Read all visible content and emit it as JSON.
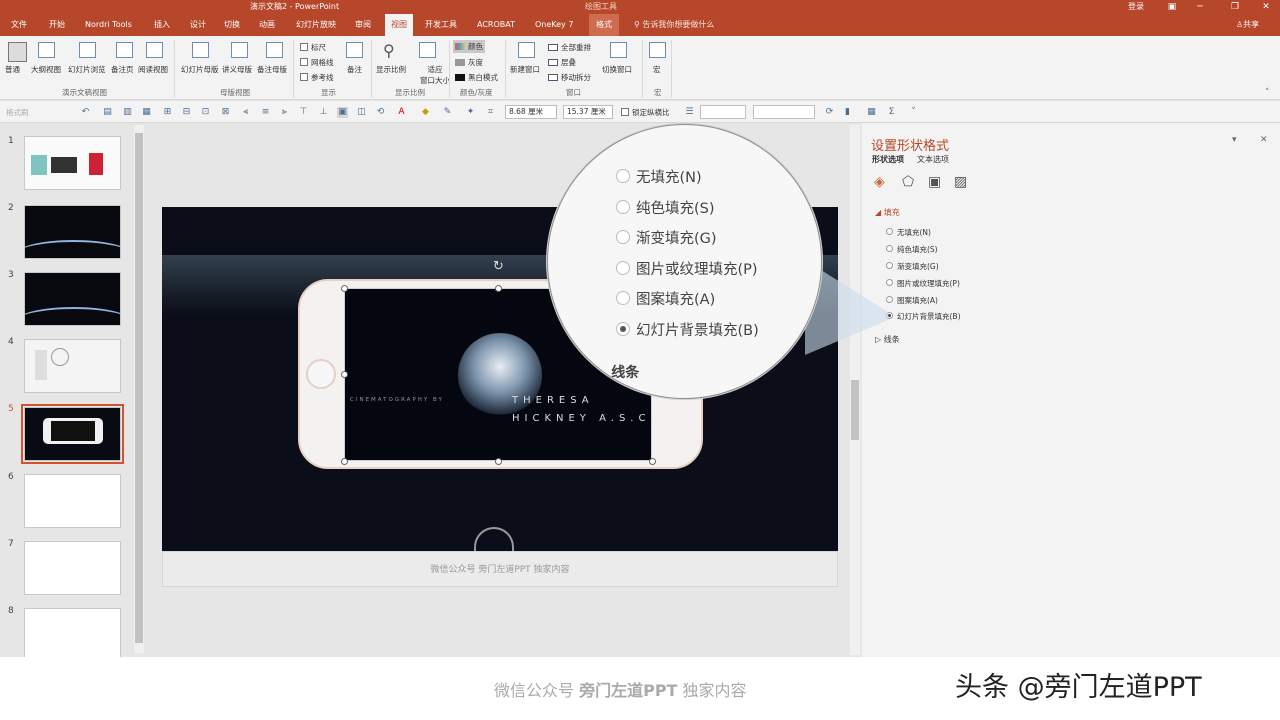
{
  "titlebar": {
    "title": "演示文稿2  -  PowerPoint",
    "context": "绘图工具",
    "login": "登录",
    "share": "共享"
  },
  "tabs": [
    {
      "label": "文件",
      "active": false
    },
    {
      "label": "开始",
      "active": false
    },
    {
      "label": "Nordri Tools",
      "active": false
    },
    {
      "label": "插入",
      "active": false
    },
    {
      "label": "设计",
      "active": false
    },
    {
      "label": "切换",
      "active": false
    },
    {
      "label": "动画",
      "active": false
    },
    {
      "label": "幻灯片放映",
      "active": false
    },
    {
      "label": "审阅",
      "active": false
    },
    {
      "label": "视图",
      "active": true
    },
    {
      "label": "开发工具",
      "active": false
    },
    {
      "label": "ACROBAT",
      "active": false
    },
    {
      "label": "OneKey 7",
      "active": false
    },
    {
      "label": "格式",
      "active": false
    }
  ],
  "tell_me": "告诉我你想要做什么",
  "ribbon": {
    "presentation_views": [
      "普通",
      "大纲视图",
      "幻灯片浏览",
      "备注页",
      "阅读视图"
    ],
    "master_views": [
      "幻灯片母版",
      "讲义母版",
      "备注母版"
    ],
    "show": {
      "ruler": "标尺",
      "gridlines": "网格线",
      "guides": "参考线",
      "notes": "备注"
    },
    "zoom": {
      "zoom": "显示比例",
      "fit": "适应",
      "fit2": "窗口大小"
    },
    "color": {
      "color": "颜色",
      "grayscale": "灰度",
      "bw": "黑白模式"
    },
    "window": {
      "new_window": "新建窗口",
      "arrange_all": "全部重排",
      "cascade": "层叠",
      "move_split": "移动拆分",
      "switch_window": "切换窗口"
    },
    "macros": "宏",
    "groups": [
      "演示文稿视图",
      "母版视图",
      "显示",
      "显示比例",
      "颜色/灰度",
      "窗口",
      "宏"
    ]
  },
  "qat": {
    "format_painter": "格式刷",
    "height": "8.68 厘米",
    "width": "15.37 厘米",
    "lock_ratio": "锁定纵横比"
  },
  "slides": [
    {
      "number": "1"
    },
    {
      "number": "2"
    },
    {
      "number": "3"
    },
    {
      "number": "4"
    },
    {
      "number": "5"
    },
    {
      "number": "6"
    },
    {
      "number": "7"
    },
    {
      "number": "8"
    }
  ],
  "selected_slide": "5",
  "canvas": {
    "subtitle": "CINEMATOGRAPHY BY",
    "name_line1": "THERESA",
    "name_line2": "HICKNEY A.S.C."
  },
  "notes_text": "微信公众号 旁门左道PPT 独家内容",
  "panel": {
    "title": "设置形状格式",
    "tab_shape": "形状选项",
    "tab_text": "文本选项",
    "fill_section": "填充",
    "options": [
      {
        "label": "无填充(N)",
        "selected": false
      },
      {
        "label": "纯色填充(S)",
        "selected": false
      },
      {
        "label": "渐变填充(G)",
        "selected": false
      },
      {
        "label": "图片或纹理填充(P)",
        "selected": false
      },
      {
        "label": "图案填充(A)",
        "selected": false
      },
      {
        "label": "幻灯片背景填充(B)",
        "selected": true
      }
    ],
    "line_section": "线条"
  },
  "magnifier": {
    "options": [
      {
        "label": "无填充(N)",
        "selected": false
      },
      {
        "label": "纯色填充(S)",
        "selected": false
      },
      {
        "label": "渐变填充(G)",
        "selected": false
      },
      {
        "label": "图片或纹理填充(P)",
        "selected": false
      },
      {
        "label": "图案填充(A)",
        "selected": false
      },
      {
        "label": "幻灯片背景填充(B)",
        "selected": true
      }
    ],
    "line_section": "线条"
  },
  "footer": {
    "watermark_pre": "微信公众号 ",
    "watermark_bold": "旁门左道PPT",
    "watermark_post": " 独家内容",
    "brand": "头条 @旁门左道PPT"
  },
  "colors": {
    "accent": "#b7472a",
    "selection": "#d35230",
    "slide_bg": "#0b0e18"
  }
}
